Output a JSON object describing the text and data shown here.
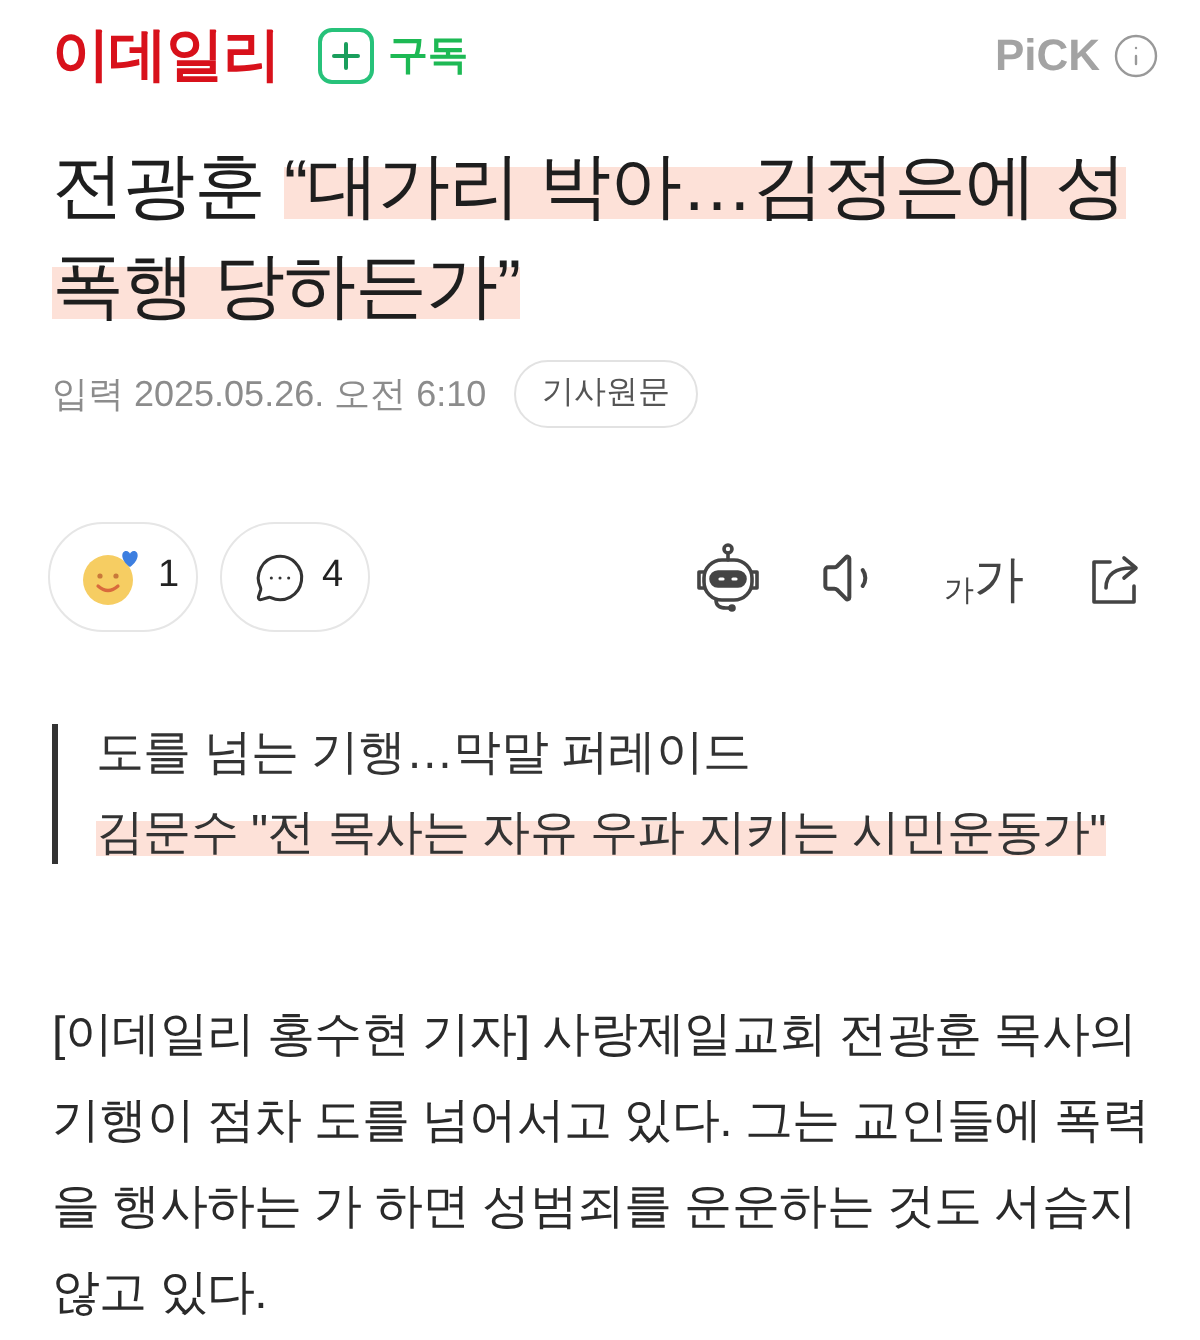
{
  "header": {
    "logo": "이데일리",
    "subscribe": {
      "label": "구독"
    },
    "pick": {
      "label": "PiCK"
    }
  },
  "article": {
    "title": {
      "speaker": "전광훈",
      "quote": "“대가리 박아…김정은에 성폭행 당하든가”",
      "highlighted": true
    },
    "meta": {
      "published": "입력 2025.05.26. 오전 6:10",
      "original_button": "기사원문"
    },
    "actions": {
      "reactions": {
        "count": "1"
      },
      "comments": {
        "count": "4"
      },
      "tools": [
        {
          "kind": "robot"
        },
        {
          "kind": "speaker"
        },
        {
          "kind": "font_size",
          "small": "가",
          "large": "가"
        },
        {
          "kind": "share"
        }
      ]
    },
    "subheadings": [
      {
        "text": "도를 넘는 기행…막말 퍼레이드",
        "highlighted": false
      },
      {
        "text": "김문수 \"전 목사는 자유 우파 지키는 시민운동가\"",
        "highlighted": true
      }
    ],
    "body": [
      "[이데일리 홍수현 기자] 사랑제일교회 전광훈 목사의 기행이 점차 도를 넘어서고 있다. 그는 교인들에 폭력을 행사하는 가 하면 성범죄를 운운하는 것도 서슴지 않고 있다."
    ]
  }
}
